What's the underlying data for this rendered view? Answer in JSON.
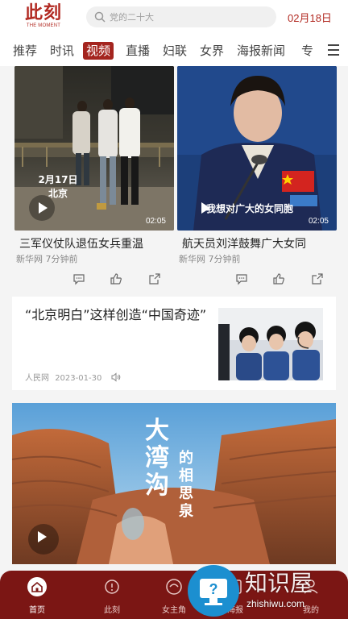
{
  "header": {
    "logo_cn": "此刻",
    "logo_en": "THE MOMENT",
    "search_placeholder": "党的二十大",
    "date": "02月18日"
  },
  "tabs": [
    {
      "label": "推荐"
    },
    {
      "label": "时讯"
    },
    {
      "label": "视频",
      "active": true
    },
    {
      "label": "直播"
    },
    {
      "label": "妇联"
    },
    {
      "label": "女界"
    },
    {
      "label": "海报新闻"
    },
    {
      "label": "专"
    }
  ],
  "videos": [
    {
      "overlay_date": "2月17日",
      "overlay_place": "北京",
      "duration": "02:05",
      "title": "三军仪仗队退伍女兵重温",
      "source": "新华网",
      "time": "7分钟前"
    },
    {
      "overlay_caption": "我想对广大的女同胞",
      "duration": "02:05",
      "title": "航天员刘洋鼓舞广大女同",
      "source": "新华网",
      "time": "7分钟前"
    }
  ],
  "article": {
    "title": "“北京明白”这样创造“中国奇迹”",
    "source": "人民网",
    "date": "2023-01-30"
  },
  "big_video": {
    "chars_big": [
      "大",
      "湾",
      "沟"
    ],
    "chars_small": [
      "的",
      "相",
      "思",
      "泉"
    ]
  },
  "bottom_nav": [
    {
      "label": "首页",
      "icon": "home-icon",
      "active": true
    },
    {
      "label": "此刻",
      "icon": "moment-icon"
    },
    {
      "label": "女主角",
      "icon": "heroine-icon"
    },
    {
      "label": "海报",
      "icon": "poster-icon"
    },
    {
      "label": "我的",
      "icon": "user-icon"
    }
  ],
  "watermark": {
    "text": "知识屋",
    "url": "zhishiwu.com"
  },
  "colors": {
    "brand": "#b22a22",
    "tab_active": "#a4251f",
    "nav_bg": "#7b1614"
  }
}
